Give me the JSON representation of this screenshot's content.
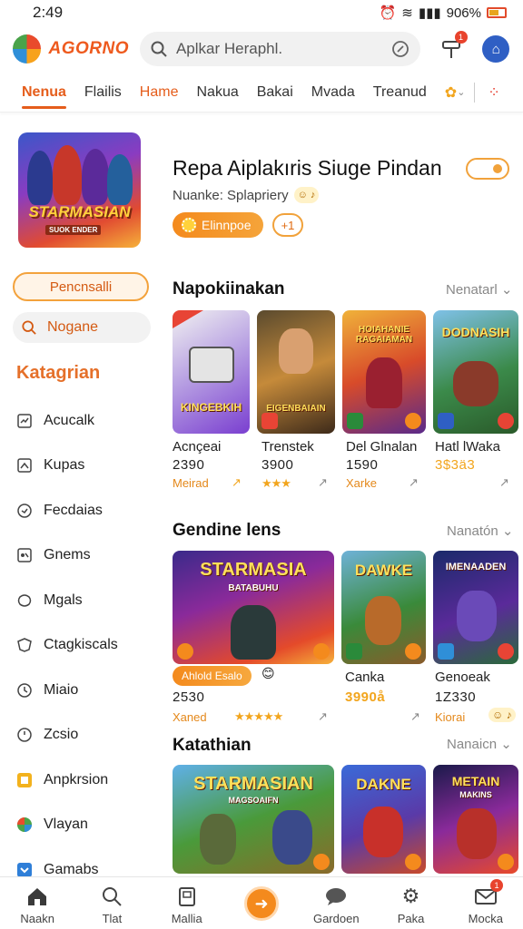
{
  "status_bar": {
    "time": "2:49",
    "battery": "906%"
  },
  "header": {
    "logo_text": "AGORNO",
    "search_placeholder": "Aplkar Heraphl.",
    "notification_count": "1"
  },
  "tabs": [
    {
      "label": "Nenua",
      "active": true
    },
    {
      "label": "Flailis"
    },
    {
      "label": "Hame",
      "highlight": true
    },
    {
      "label": "Nakua"
    },
    {
      "label": "Bakai"
    },
    {
      "label": "Mvada"
    },
    {
      "label": "Treanud"
    }
  ],
  "featured": {
    "image_label": "STARMASIAN",
    "image_sublabel": "SUOK ENDER",
    "title": "Repa Aiplakıris Siuge Pindan",
    "subtitle": "Nuanke: Splapriery",
    "button_label": "Elinnpoe",
    "plus_label": "+1"
  },
  "sidebar": {
    "primary_button": "Pencnsalli",
    "search_label": "Nogane",
    "categories_title": "Katagrian",
    "categories": [
      {
        "label": "Acucalk",
        "icon": "controller-icon"
      },
      {
        "label": "Kupas",
        "icon": "chart-icon"
      },
      {
        "label": "Fecdaias",
        "icon": "clock-icon"
      },
      {
        "label": "Gnems",
        "icon": "gamepad-icon"
      },
      {
        "label": "Mgals",
        "icon": "puzzle-icon"
      },
      {
        "label": "Ctagkiscals",
        "icon": "shield-icon"
      },
      {
        "label": "Miaio",
        "icon": "compass-icon"
      },
      {
        "label": "Zcsio",
        "icon": "timer-icon"
      },
      {
        "label": "Anpkrsion",
        "icon": "yellow-square-icon"
      },
      {
        "label": "Vlayan",
        "icon": "globe-icon"
      },
      {
        "label": "Gamabs",
        "icon": "blue-tag-icon"
      }
    ]
  },
  "section1": {
    "title": "Napokiinakan",
    "more": "Nenatarl",
    "cards": [
      {
        "image_label": "KINGEBKIH",
        "name": "Acnçeai",
        "value": "2390",
        "meta": "Meirad"
      },
      {
        "image_label": "EIGENBAIAIN",
        "name": "Trenstek",
        "value": "3900",
        "meta": "★★★"
      },
      {
        "image_label": "HOIAHANIE RAGAIAMAN",
        "name": "Del Glnalan",
        "value": "1590",
        "meta": "Xarke"
      },
      {
        "image_label": "DODNASIH",
        "name": "Hatl lWaka",
        "value": "3$3ä3",
        "meta": ""
      }
    ]
  },
  "section2": {
    "title": "Gendine lens",
    "more": "Nanatón",
    "cards": [
      {
        "image_label": "STARMASIA",
        "image_sublabel": "BATABUHU",
        "pill": "Ahlold Esalo",
        "value": "2530",
        "meta": "Xaned",
        "stars": "★★★★★"
      },
      {
        "image_label": "DAWKE",
        "name": "Canka",
        "value": "3990å",
        "meta": ""
      },
      {
        "image_label": "IMENAADEN",
        "name": "Genoeak",
        "value": "1Z330",
        "meta": "Kiorai"
      }
    ]
  },
  "section3": {
    "title": "Katathian",
    "more": "Nanaicn",
    "cards": [
      {
        "image_label": "STARMASIAN",
        "image_sublabel": "MAGSOAIFN"
      },
      {
        "image_label": "DAKNE"
      },
      {
        "image_label": "METAIN",
        "image_sublabel": "MAKINS"
      }
    ]
  },
  "bottom_nav": [
    {
      "label": "Naakn",
      "icon": "home-icon"
    },
    {
      "label": "Tlat",
      "icon": "search-icon"
    },
    {
      "label": "Mallia",
      "icon": "library-icon"
    },
    {
      "label": "",
      "icon": "play-icon"
    },
    {
      "label": "Gardoen",
      "icon": "chat-icon"
    },
    {
      "label": "Paka",
      "icon": "gear-icon"
    },
    {
      "label": "Mocka",
      "icon": "mail-icon",
      "badge": "1"
    }
  ]
}
